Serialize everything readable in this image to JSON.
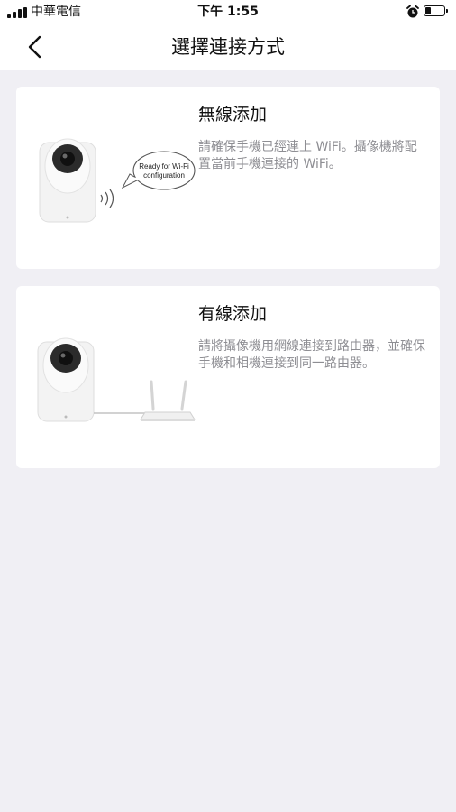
{
  "status_bar": {
    "carrier": "中華電信",
    "time": "下午 1:55"
  },
  "nav": {
    "title": "選擇連接方式",
    "back_icon": "chevron-left-icon"
  },
  "options": [
    {
      "title": "無線添加",
      "description": "請確保手機已經連上 WiFi。攝像機將配置當前手機連接的 WiFi。",
      "bubble_line1": "Ready for Wi-Fi",
      "bubble_line2": "configuration"
    },
    {
      "title": "有線添加",
      "description": "請將攝像機用網線連接到路由器，並確保手機和相機連接到同一路由器。"
    }
  ]
}
